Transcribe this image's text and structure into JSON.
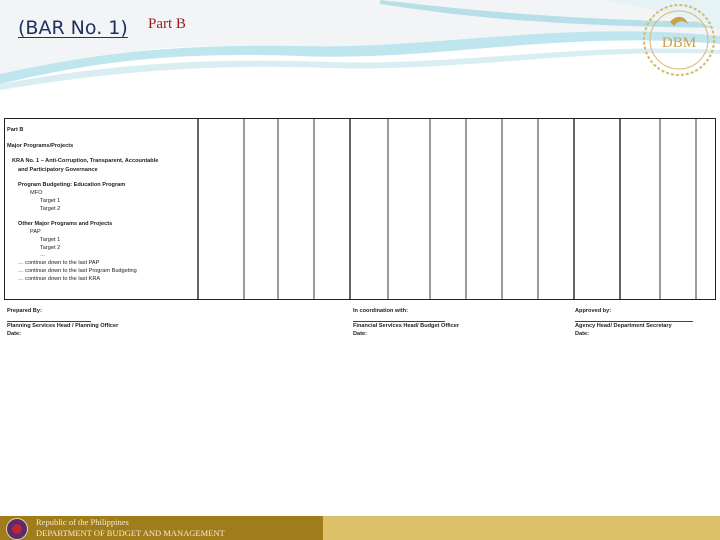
{
  "header": {
    "title": "(BAR No. 1)",
    "subtitle": "Part B",
    "logo_text": "DBM"
  },
  "form": {
    "part_label": "Part B",
    "section_title": "Major Programs/Projects",
    "kra_line1": "KRA No. 1 – Anti-Corruption, Transparent, Accountable",
    "kra_line2": "and Participatory Governance",
    "program_budgeting": "Program Budgeting: Education Program",
    "mfo": "MFO",
    "target1": "Target 1",
    "target2": "Target 2",
    "other_major": "Other Major Programs and Projects",
    "pap": "PAP",
    "pap_target1": "Target 1",
    "pap_target2": "Target 2",
    "ellipsis": "…",
    "continue_pap": "… continue down to the last PAP",
    "continue_program": "… continue down to the last Program Budgeting",
    "continue_kra": "… continue down to the last KRA",
    "prepared_by": "Prepared By:",
    "prepared_role": "Planning Services Head / Planning Officer",
    "prepared_date": "Date:",
    "coordination": "In coordination with:",
    "coordination_role": "Financial Services Head/ Budget Officer",
    "coordination_date": "Date:",
    "approved_by": "Approved by:",
    "approved_role": "Agency Head/ Department Secretary",
    "approved_date": "Date:"
  },
  "footer": {
    "line1": "Republic of the Philippines",
    "line2": "DEPARTMENT OF BUDGET AND MANAGEMENT"
  }
}
